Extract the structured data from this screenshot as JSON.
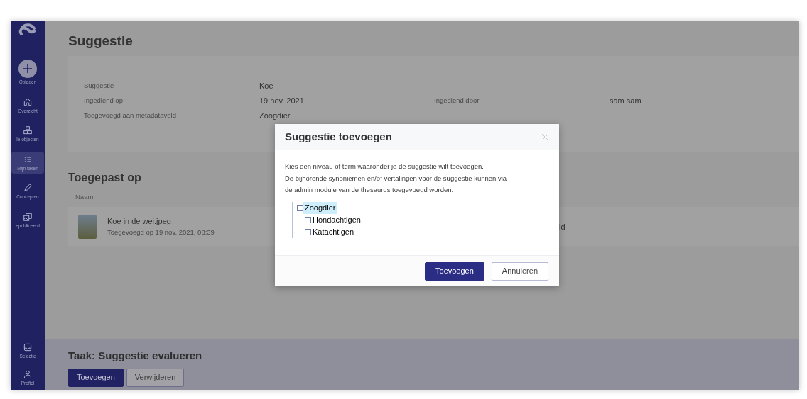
{
  "sidebar": {
    "items": [
      {
        "kind": "upload",
        "label": "Opladen",
        "selected": false
      },
      {
        "kind": "home",
        "label": "Overzicht",
        "selected": false
      },
      {
        "kind": "objects",
        "label": "le objecten",
        "selected": false
      },
      {
        "kind": "tasks",
        "label": "Mijn taken",
        "selected": true
      },
      {
        "kind": "pencil",
        "label": "Concepten",
        "selected": false
      },
      {
        "kind": "published",
        "label": "epubliceerd",
        "selected": false
      }
    ],
    "bottom_items": [
      {
        "kind": "inbox",
        "label": "Selectie",
        "selected": false
      },
      {
        "kind": "user",
        "label": "Profiel",
        "selected": false
      }
    ]
  },
  "page": {
    "title": "Suggestie",
    "details": [
      {
        "label": "Suggestie",
        "value": "Koe"
      },
      {
        "label": "Ingediend op",
        "value": "19 nov. 2021",
        "label_2": "Ingediend door",
        "value_2": "sam sam"
      },
      {
        "label": "Toegevoegd aan metadataveld",
        "value": "Zoogdier"
      }
    ],
    "applied": {
      "title": "Toegepast op",
      "columns": [
        "Naam"
      ],
      "rows": [
        {
          "name": "Koe in de wei.jpeg",
          "subtitle": "Toegevoegd op 19 nov. 2021, 08:39",
          "column_2": "ld"
        }
      ]
    },
    "task": {
      "title": "Taak: Suggestie evalueren",
      "buttons": [
        {
          "label": "Toevoegen",
          "kind": "primary"
        },
        {
          "label": "Verwijderen",
          "kind": "secondary"
        }
      ]
    }
  },
  "dialog": {
    "title": "Suggestie toevoegen",
    "lines": [
      "Kies een niveau of term waaronder je de suggestie wilt toevoegen.",
      "De bijhorende synoniemen en/of vertalingen voor de suggestie kunnen via",
      "de admin module van de thesaurus toegevoegd worden."
    ],
    "tree": [
      {
        "label": "Zoogdier",
        "expanded": true,
        "selected": true,
        "children": [
          {
            "label": "Hondachtigen",
            "expanded": false,
            "selected": false
          },
          {
            "label": "Katachtigen",
            "expanded": false,
            "selected": false
          }
        ]
      }
    ],
    "buttons": [
      {
        "label": "Toevoegen",
        "kind": "primary"
      },
      {
        "label": "Annuleren",
        "kind": "secondary"
      }
    ]
  }
}
